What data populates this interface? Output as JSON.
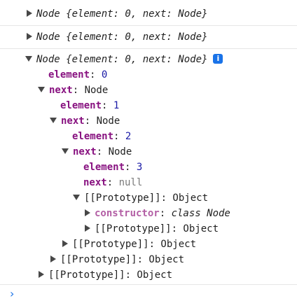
{
  "console": {
    "entries": [
      {
        "summary": "Node {element: 0, next: Node}"
      },
      {
        "summary": "Node {element: 0, next: Node}"
      },
      {
        "summary": "Node {element: 0, next: Node}"
      }
    ],
    "tree": {
      "root_element_key": "element",
      "root_element_value": "0",
      "next_key": "next",
      "next_type": "Node",
      "l2_element_key": "element",
      "l2_element_value": "1",
      "l2_next_key": "next",
      "l2_next_type": "Node",
      "l3_element_key": "element",
      "l3_element_value": "2",
      "l3_next_key": "next",
      "l3_next_type": "Node",
      "l4_element_key": "element",
      "l4_element_value": "3",
      "l4_next_key": "next",
      "l4_next_value": "null",
      "proto_l4": "[[Prototype]]: Object",
      "constructor_key": "constructor",
      "constructor_value": "class Node",
      "proto_inner": "[[Prototype]]: Object",
      "proto_l3": "[[Prototype]]: Object",
      "proto_l2": "[[Prototype]]: Object",
      "proto_l1": "[[Prototype]]: Object"
    },
    "icons": {
      "expand": "triangle-right-icon",
      "collapse": "triangle-down-icon",
      "info": "info-icon",
      "prompt": "chevron-right-icon"
    },
    "info_glyph": "i",
    "prompt_glyph": "›"
  }
}
